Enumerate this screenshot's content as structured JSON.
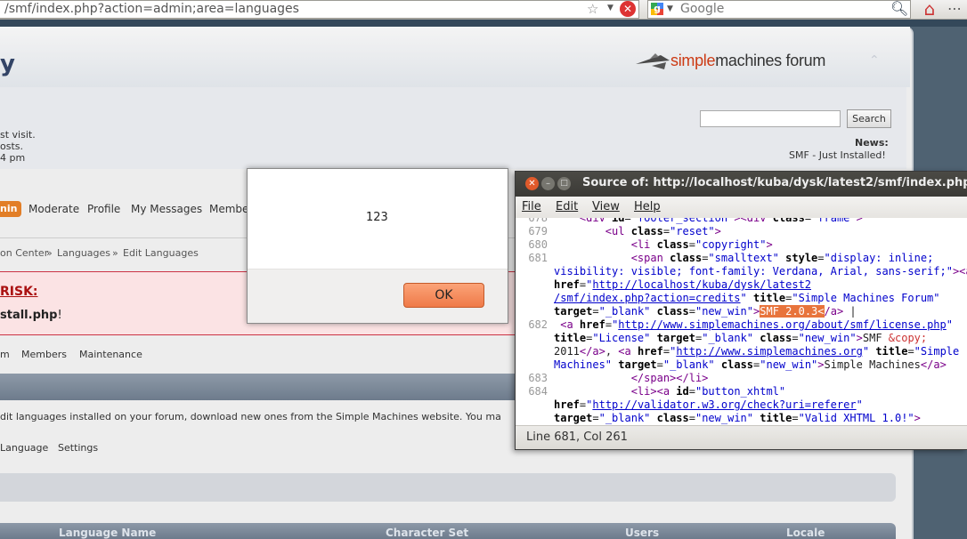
{
  "browser": {
    "url": "/smf/index.php?action=admin;area=languages",
    "search_placeholder": "Google"
  },
  "forum": {
    "title_fragment": "y",
    "logo_bold": "simple",
    "logo_mid": "machines",
    "logo_tail": " forum",
    "user_lines": [
      "st visit.",
      "osts.",
      "4 pm"
    ],
    "search_button": "Search",
    "news_label": "News:",
    "news_text": "SMF - Just Installed!",
    "menu": [
      "nin",
      "Moderate",
      "Profile",
      "My Messages",
      "Member"
    ],
    "breadcrumb": [
      "on Center",
      "»",
      "Languages",
      "»",
      "Edit Languages"
    ],
    "risk_title": "RISK:",
    "risk_file": "stall.php",
    "risk_suffix": "!",
    "subnav": [
      "m",
      "Members",
      "Maintenance"
    ],
    "description": "dit languages installed on your forum, download new ones from the Simple Machines website. You ma",
    "tabs": [
      "Language",
      "Settings"
    ],
    "table_headers": [
      "Language Name",
      "Character Set",
      "Users",
      "Locale"
    ]
  },
  "alert": {
    "message": "123",
    "ok_label": "OK"
  },
  "source_window": {
    "title": "Source of: http://localhost/kuba/dysk/latest2/smf/index.php",
    "menu": [
      "File",
      "Edit",
      "View",
      "Help"
    ],
    "status": "Line 681, Col 261",
    "line_numbers": [
      "678",
      "679",
      "680",
      "681",
      "682",
      "683",
      "684"
    ],
    "highlight": "SMF 2.0.3<"
  }
}
